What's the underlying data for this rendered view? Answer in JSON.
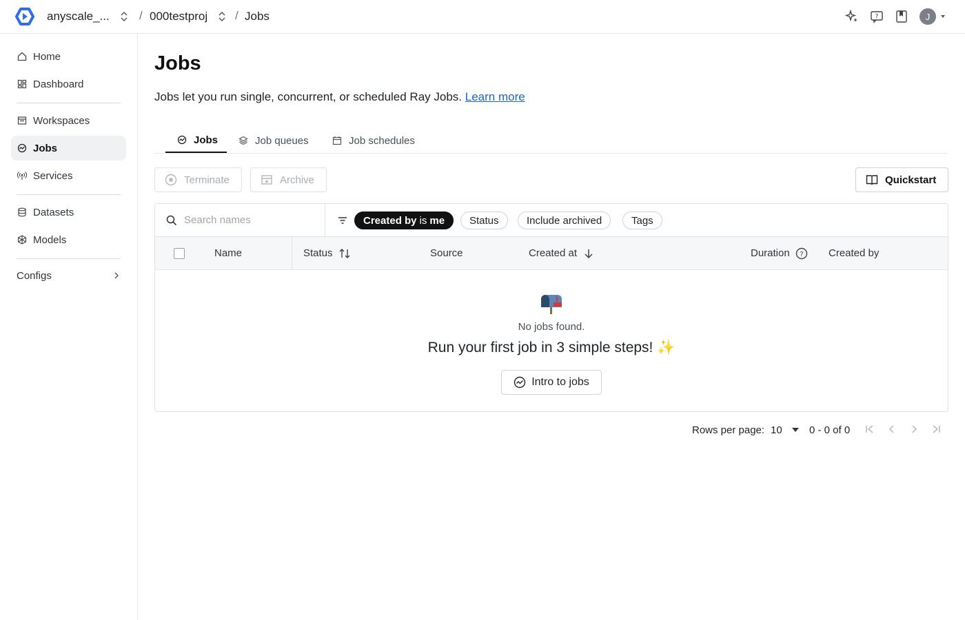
{
  "topbar": {
    "org": "anyscale_...",
    "project": "000testproj",
    "separator": "/",
    "current": "Jobs",
    "avatar_initial": "J"
  },
  "sidebar": {
    "items": [
      {
        "label": "Home",
        "icon": "home-icon"
      },
      {
        "label": "Dashboard",
        "icon": "dashboard-icon"
      },
      {
        "label": "Workspaces",
        "icon": "workspaces-icon"
      },
      {
        "label": "Jobs",
        "icon": "jobs-icon",
        "active": true
      },
      {
        "label": "Services",
        "icon": "services-icon"
      },
      {
        "label": "Datasets",
        "icon": "datasets-icon"
      },
      {
        "label": "Models",
        "icon": "models-icon"
      },
      {
        "label": "Configs",
        "icon": "chevron-right-icon"
      }
    ]
  },
  "main": {
    "title": "Jobs",
    "description": "Jobs let you run single, concurrent, or scheduled Ray Jobs.",
    "learn_more": "Learn more",
    "tabs": [
      {
        "label": "Jobs",
        "active": true
      },
      {
        "label": "Job queues"
      },
      {
        "label": "Job schedules"
      }
    ],
    "actions": {
      "terminate": "Terminate",
      "archive": "Archive",
      "quickstart": "Quickstart"
    }
  },
  "filters": {
    "search_placeholder": "Search names",
    "created_by_key": "Created by",
    "created_by_op": "is",
    "created_by_value": "me",
    "status": "Status",
    "include_archived": "Include archived",
    "tags": "Tags"
  },
  "table": {
    "columns": [
      "Name",
      "Status",
      "Source",
      "Created at",
      "Duration",
      "Created by"
    ],
    "rows": []
  },
  "empty_state": {
    "message": "No jobs found.",
    "headline": "Run your first job in 3 simple steps!",
    "sparkle": "✨",
    "button": "Intro to jobs"
  },
  "pagination": {
    "rows_per_page_label": "Rows per page:",
    "rows_per_page": "10",
    "range": "0 - 0 of 0"
  },
  "colors": {
    "accent_dark": "#111111",
    "link": "#1a66c9",
    "border": "#dfe2e6",
    "logo_blue": "#2f6fe4"
  }
}
